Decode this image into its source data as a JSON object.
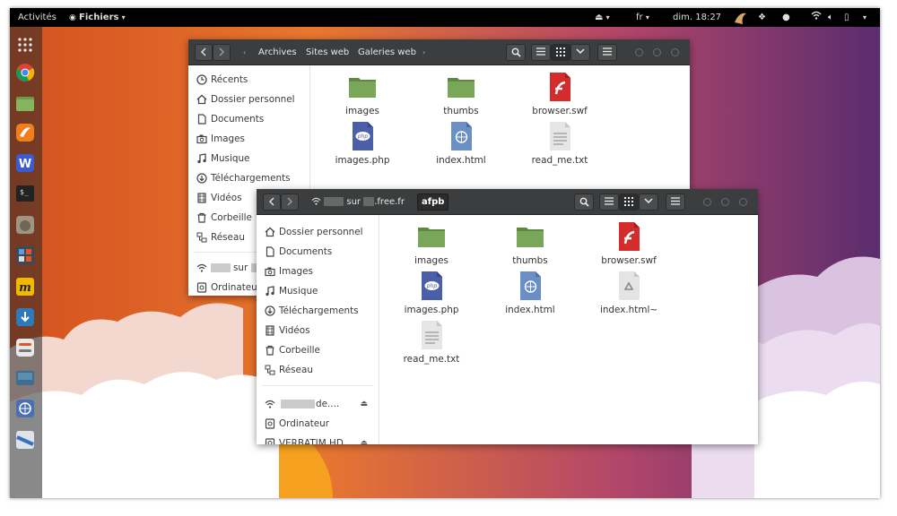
{
  "topbar": {
    "activities": "Activités",
    "app_menu": "Fichiers",
    "lang": "fr",
    "clock": "dim. 18:27"
  },
  "dock": {
    "icons": [
      "grid-icon",
      "chrome-icon",
      "files-icon",
      "thunderbird-icon",
      "wps-writer-icon",
      "terminal-icon",
      "gimp-icon",
      "calculator-icon",
      "mega-icon",
      "install-icon",
      "settings-icon",
      "screen-icon",
      "network-icon",
      "disk-icon"
    ]
  },
  "back_window": {
    "breadcrumbs": [
      "Archives",
      "Sites web",
      "Galeries web"
    ],
    "sidebar": [
      {
        "label": "Récents",
        "icon": "clock-icon"
      },
      {
        "label": "Dossier personnel",
        "icon": "home-icon"
      },
      {
        "label": "Documents",
        "icon": "document-icon"
      },
      {
        "label": "Images",
        "icon": "camera-icon"
      },
      {
        "label": "Musique",
        "icon": "music-icon"
      },
      {
        "label": "Téléchargements",
        "icon": "download-icon"
      },
      {
        "label": "Vidéos",
        "icon": "film-icon"
      },
      {
        "label": "Corbeille",
        "icon": "trash-icon"
      },
      {
        "label": "Réseau",
        "icon": "network-icon"
      },
      {
        "label": "sur",
        "icon": "wifi-icon"
      },
      {
        "label": "Ordinateur",
        "icon": "computer-icon"
      }
    ],
    "files": [
      {
        "name": "images",
        "type": "folder"
      },
      {
        "name": "thumbs",
        "type": "folder"
      },
      {
        "name": "browser.swf",
        "type": "flash"
      },
      {
        "name": "images.php",
        "type": "php"
      },
      {
        "name": "index.html",
        "type": "html"
      },
      {
        "name": "read_me.txt",
        "type": "text"
      }
    ]
  },
  "front_window": {
    "location": "sur",
    "location_suffix": ".free.fr",
    "current_folder": "afpb",
    "sidebar": [
      {
        "label": "Dossier personnel",
        "icon": "home-icon"
      },
      {
        "label": "Documents",
        "icon": "document-icon"
      },
      {
        "label": "Images",
        "icon": "camera-icon"
      },
      {
        "label": "Musique",
        "icon": "music-icon"
      },
      {
        "label": "Téléchargements",
        "icon": "download-icon"
      },
      {
        "label": "Vidéos",
        "icon": "film-icon"
      },
      {
        "label": "Corbeille",
        "icon": "trash-icon"
      },
      {
        "label": "Réseau",
        "icon": "network-icon"
      }
    ],
    "sidebar_extra": [
      {
        "label": "de....",
        "icon": "wifi-icon",
        "eject": "⏏"
      },
      {
        "label": "Ordinateur",
        "icon": "computer-icon"
      },
      {
        "label": "VERBATIM HD",
        "icon": "disk-icon",
        "eject": "⏏"
      }
    ],
    "files": [
      {
        "name": "images",
        "type": "folder"
      },
      {
        "name": "thumbs",
        "type": "folder"
      },
      {
        "name": "browser.swf",
        "type": "flash"
      },
      {
        "name": "images.php",
        "type": "php"
      },
      {
        "name": "index.html",
        "type": "html"
      },
      {
        "name": "index.html~",
        "type": "backup"
      },
      {
        "name": "read_me.txt",
        "type": "text"
      }
    ]
  },
  "colors": {
    "folder": "#7aa65a",
    "flash": "#d42c2c",
    "php": "#4a5fa8",
    "html": "#6a8fc4",
    "accent": "#e8643a"
  }
}
